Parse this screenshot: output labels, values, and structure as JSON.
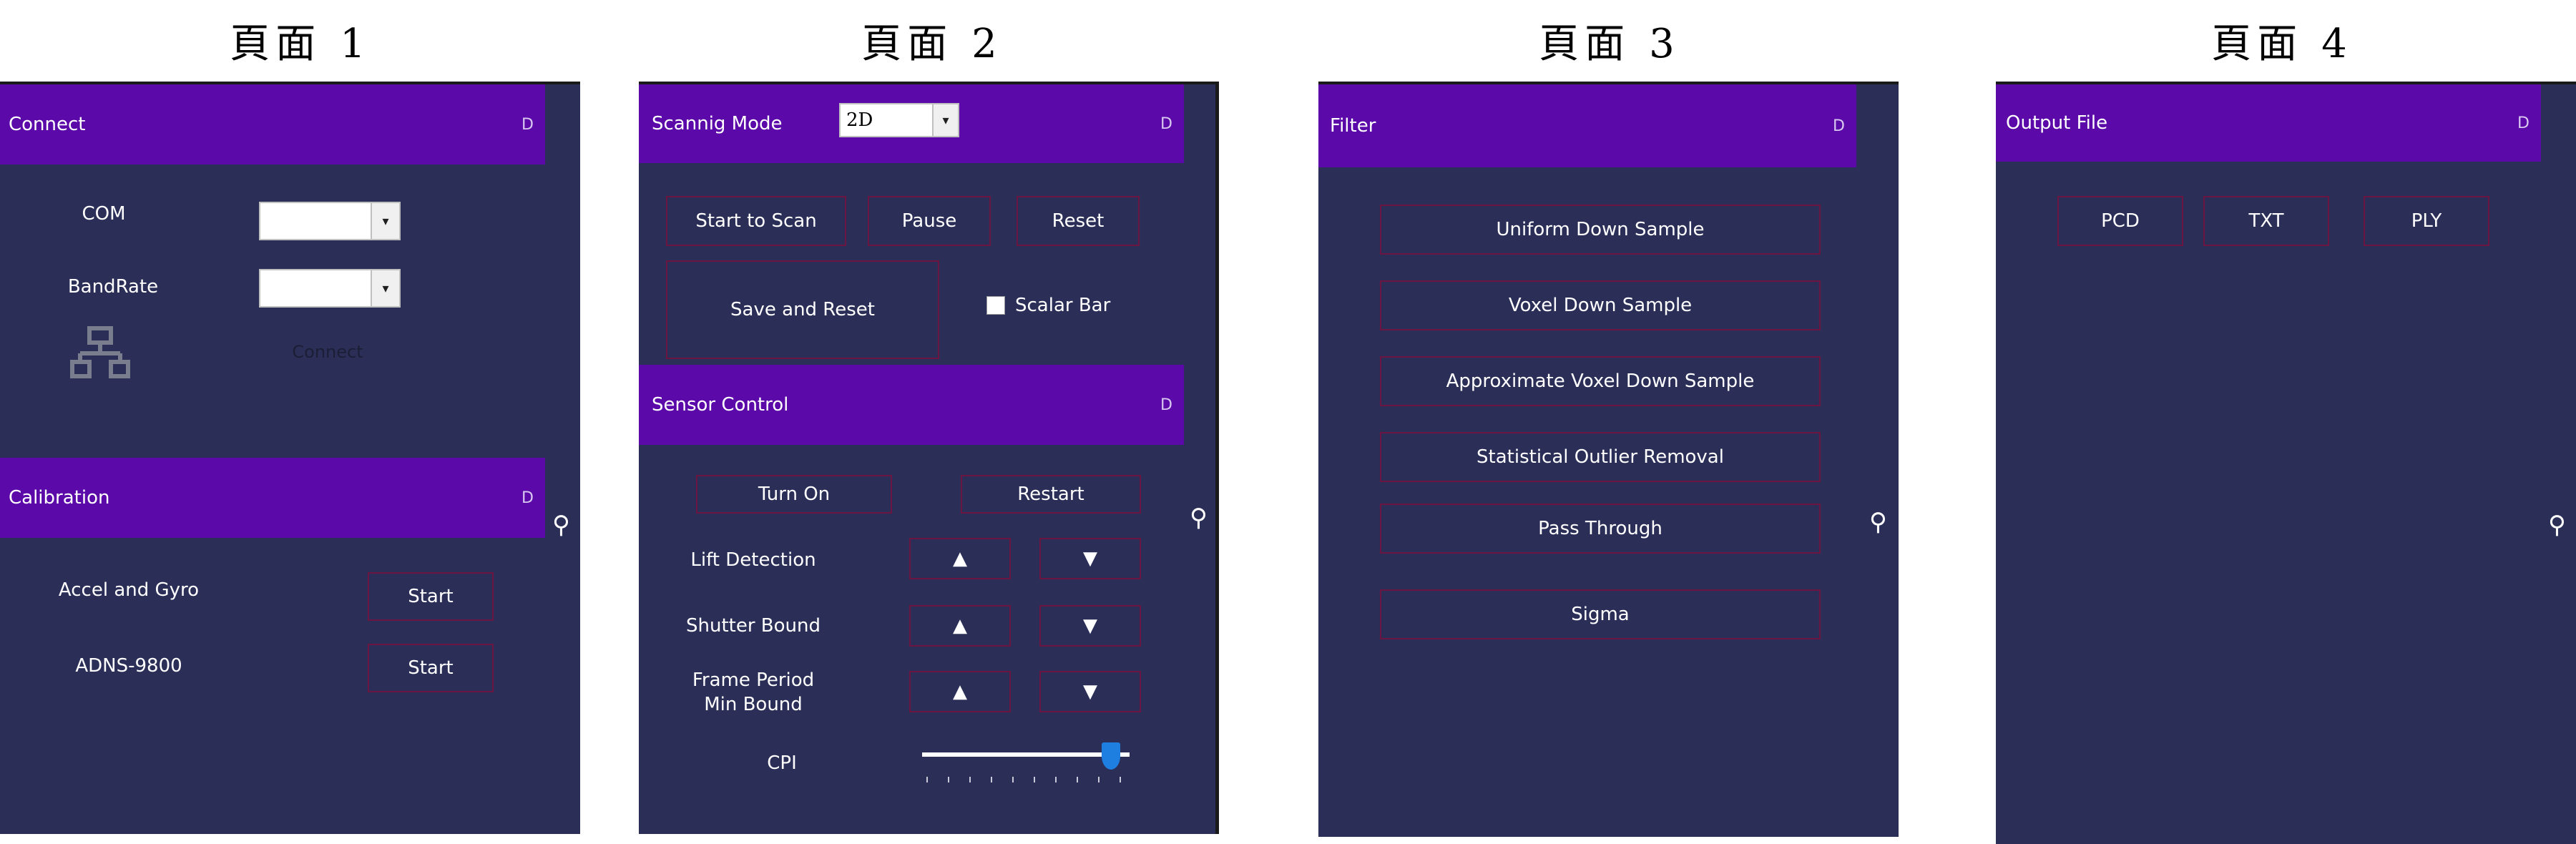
{
  "captions": [
    "頁面 1",
    "頁面 2",
    "頁面 3",
    "頁面 4"
  ],
  "page1": {
    "connect": {
      "header": "Connect",
      "dock": "D",
      "com_label": "COM",
      "com_value": "",
      "bandrate_label": "BandRate",
      "bandrate_value": "",
      "connect_label": "Connect"
    },
    "calibration": {
      "header": "Calibration",
      "dock": "D",
      "rows": [
        {
          "label": "Accel  and Gyro",
          "button": "Start"
        },
        {
          "label": "ADNS-9800",
          "button": "Start"
        }
      ]
    },
    "pin": "⚲"
  },
  "page2": {
    "scan": {
      "header": "Scannig Mode",
      "mode_value": "2D",
      "dock": "D",
      "start_button": "Start to Scan",
      "pause_button": "Pause",
      "reset_button": "Reset",
      "save_reset_button": "Save and Reset",
      "scalar_bar_label": "Scalar Bar",
      "scalar_bar_checked": false
    },
    "sensor": {
      "header": "Sensor Control",
      "dock": "D",
      "turn_on_button": "Turn On",
      "restart_button": "Restart",
      "rows": [
        {
          "label": "Lift Detection",
          "up": "▲",
          "down": "▼"
        },
        {
          "label": "Shutter Bound",
          "up": "▲",
          "down": "▼"
        },
        {
          "label_line1": "Frame Period",
          "label_line2": "Min Bound",
          "up": "▲",
          "down": "▼"
        }
      ],
      "cpi_label": "CPI",
      "cpi_level": 0.95
    },
    "pin": "⚲"
  },
  "page3": {
    "header": "Filter",
    "dock": "D",
    "buttons": [
      "Uniform Down Sample",
      "Voxel Down Sample",
      "Approximate Voxel Down Sample",
      "Statistical Outlier Removal",
      "Pass Through",
      "Sigma"
    ],
    "pin": "⚲"
  },
  "page4": {
    "header": "Output File",
    "dock": "D",
    "buttons": [
      "PCD",
      "TXT",
      "PLY"
    ],
    "pin": "⚲"
  },
  "colors": {
    "panel_bg": "#2b2f58",
    "header_bg": "#5b09a8",
    "button_border": "#6a1542",
    "slider_thumb": "#1e7fe0"
  }
}
